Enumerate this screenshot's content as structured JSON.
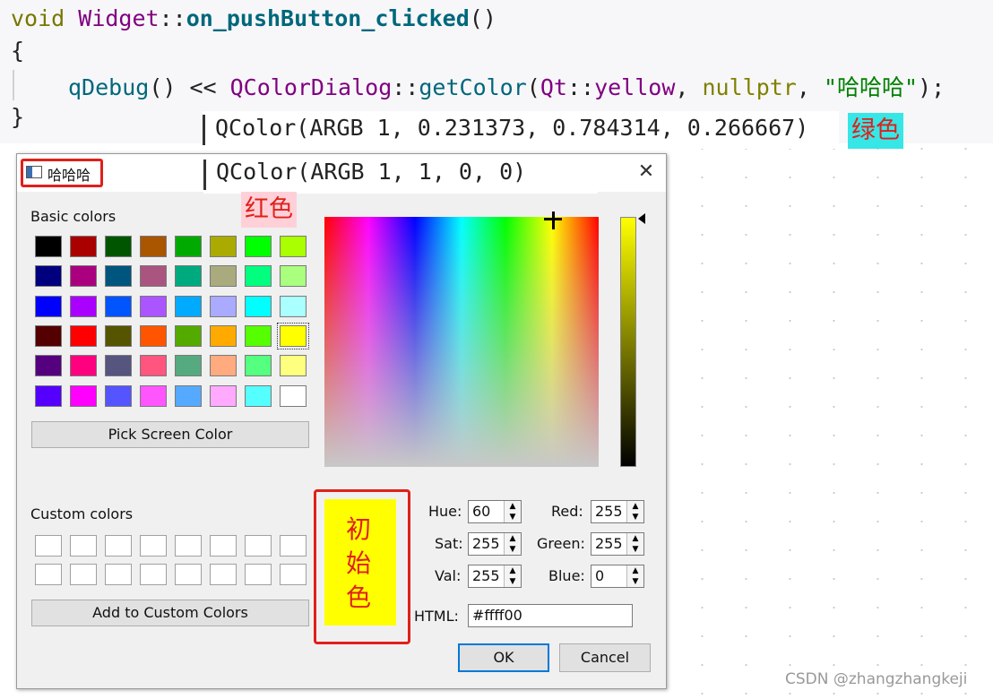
{
  "code": {
    "line1": {
      "kw": "void ",
      "cls": "Widget",
      "sep": "::",
      "fn": "on_pushButton_clicked",
      "paren": "()"
    },
    "line2": "{",
    "line3": {
      "fn": "qDebug",
      "op": "() << ",
      "cls": "QColorDialog",
      "sep": "::",
      "fn2": "getColor",
      "p1": "(",
      "qt": "Qt",
      "sep2": "::",
      "ylw": "yellow",
      "comma": ", ",
      "np": "nullptr",
      "comma2": ", ",
      "str": "\"哈哈哈\"",
      "end": ");"
    },
    "line4": "}"
  },
  "outputs": [
    {
      "text": "QColor(ARGB 1, 0.231373, 0.784314, 0.266667)"
    },
    {
      "text": "QColor(ARGB 1, 1, 0, 0)"
    }
  ],
  "badges": {
    "green": {
      "text": "绿色",
      "color": "#e0201a",
      "bg": "#37e6e6"
    },
    "red": {
      "text": "红色",
      "color": "#e0201a",
      "bg": "#ffd0d8"
    }
  },
  "dialog": {
    "title": "哈哈哈",
    "close": "✕",
    "basic_colors_label": "Basic colors",
    "basic_colors": [
      "#000000",
      "#aa0000",
      "#005500",
      "#aa5500",
      "#00aa00",
      "#aaaa00",
      "#00ff00",
      "#aaff00",
      "#00007f",
      "#aa007f",
      "#00557f",
      "#aa557f",
      "#00aa7f",
      "#aaaa7f",
      "#00ff7f",
      "#aaff7f",
      "#0000ff",
      "#aa00ff",
      "#0055ff",
      "#aa55ff",
      "#00aaff",
      "#aaaaff",
      "#00ffff",
      "#aaffff",
      "#550000",
      "#ff0000",
      "#555500",
      "#ff5500",
      "#55aa00",
      "#ffaa00",
      "#55ff00",
      "#ffff00",
      "#55007f",
      "#ff007f",
      "#55557f",
      "#ff557f",
      "#55aa7f",
      "#ffaa7f",
      "#55ff7f",
      "#ffff7f",
      "#5500ff",
      "#ff00ff",
      "#5555ff",
      "#ff55ff",
      "#55aaff",
      "#ffaaff",
      "#55ffff",
      "#ffffff"
    ],
    "selected_index": 31,
    "pick_screen_color": "Pick Screen Color",
    "custom_colors_label": "Custom colors",
    "add_to_custom": "Add to Custom Colors",
    "initial_color_note": "初始色",
    "hue_label": "Hue:",
    "hue": "60",
    "sat_label": "Sat:",
    "sat": "255",
    "val_label": "Val:",
    "val": "255",
    "red_label": "Red:",
    "red": "255",
    "green_label": "Green:",
    "green": "255",
    "blue_label": "Blue:",
    "blue": "0",
    "html_label": "HTML:",
    "html": "#ffff00",
    "ok": "OK",
    "cancel": "Cancel"
  },
  "watermark": "CSDN @zhangzhangkeji"
}
